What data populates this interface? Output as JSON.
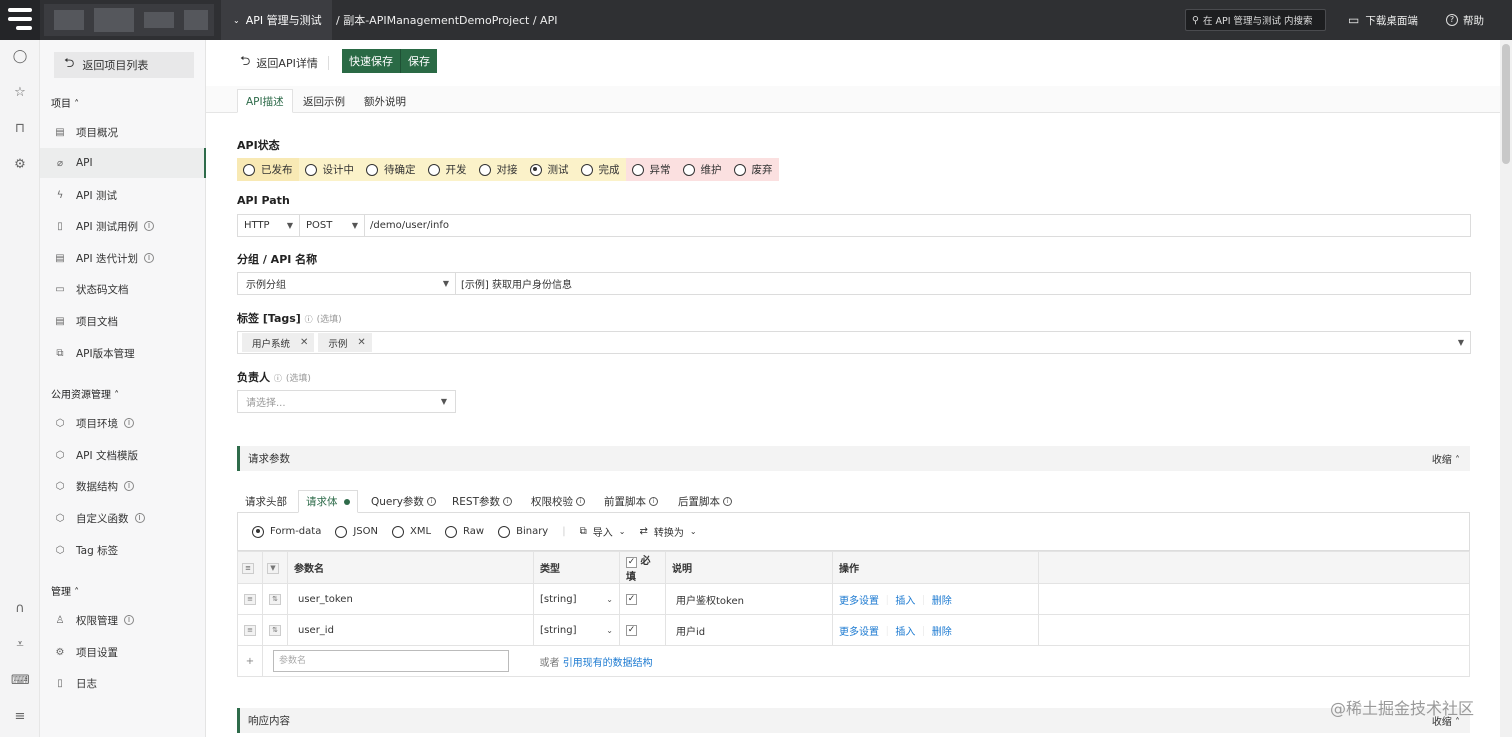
{
  "topbar": {
    "module_label": "API 管理与测试",
    "breadcrumb": "/ 副本-APIManagementDemoProject / API",
    "search_placeholder": "在 API 管理与测试 内搜索",
    "download_label": "下载桌面端",
    "help_label": "帮助"
  },
  "sidebar": {
    "back_label": "返回项目列表",
    "section_project": "项目",
    "section_public": "公用资源管理",
    "section_manage": "管理",
    "project_items": [
      {
        "label": "项目概况"
      },
      {
        "label": "API"
      },
      {
        "label": "API 测试"
      },
      {
        "label": "API 测试用例"
      },
      {
        "label": "API 迭代计划"
      },
      {
        "label": "状态码文档"
      },
      {
        "label": "项目文档"
      },
      {
        "label": "API版本管理"
      }
    ],
    "public_items": [
      {
        "label": "项目环境"
      },
      {
        "label": "API 文档模版"
      },
      {
        "label": "数据结构"
      },
      {
        "label": "自定义函数"
      },
      {
        "label": "Tag 标签"
      }
    ],
    "manage_items": [
      {
        "label": "权限管理"
      },
      {
        "label": "项目设置"
      },
      {
        "label": "日志"
      }
    ]
  },
  "toolbar": {
    "back_label": "返回API详情",
    "quick_save": "快速保存",
    "save": "保存"
  },
  "subtabs": [
    "API描述",
    "返回示例",
    "额外说明"
  ],
  "form": {
    "status_label": "API状态",
    "statuses": [
      {
        "label": "已发布",
        "color": "#f8e9b4"
      },
      {
        "label": "设计中",
        "color": "#fbf2c9"
      },
      {
        "label": "待确定",
        "color": "#fbf2c9"
      },
      {
        "label": "开发",
        "color": "#fbf2c9"
      },
      {
        "label": "对接",
        "color": "#fbf2c9"
      },
      {
        "label": "测试",
        "color": "#fbf2c9"
      },
      {
        "label": "完成",
        "color": "#fbf2c9"
      },
      {
        "label": "异常",
        "color": "#fbe0e0"
      },
      {
        "label": "维护",
        "color": "#fbe0e0"
      },
      {
        "label": "废弃",
        "color": "#fbe0e0"
      }
    ],
    "selected_status": "测试",
    "path_label": "API Path",
    "protocol": "HTTP",
    "method": "POST",
    "path": "/demo/user/info",
    "name_label": "分组 / API 名称",
    "group": "示例分组",
    "api_name": "[示例] 获取用户身份信息",
    "tags_label": "标签 [Tags]",
    "optional": "(选填)",
    "tags": [
      "用户系统",
      "示例"
    ],
    "owner_label": "负责人",
    "owner_placeholder": "请选择..."
  },
  "request": {
    "title": "请求参数",
    "collapse": "收缩",
    "tabs": [
      {
        "label": "请求头部"
      },
      {
        "label": "请求体"
      },
      {
        "label": "Query参数"
      },
      {
        "label": "REST参数"
      },
      {
        "label": "权限校验"
      },
      {
        "label": "前置脚本"
      },
      {
        "label": "后置脚本"
      }
    ],
    "body_types": [
      "Form-data",
      "JSON",
      "XML",
      "Raw",
      "Binary"
    ],
    "selected_body_type": "Form-data",
    "import_label": "导入",
    "convert_label": "转换为",
    "columns": {
      "name": "参数名",
      "type": "类型",
      "required": "必填",
      "desc": "说明",
      "ops": "操作"
    },
    "rows": [
      {
        "name": "user_token",
        "type": "[string]",
        "desc": "用户鉴权token",
        "more": "更多设置",
        "insert": "插入",
        "delete": "删除"
      },
      {
        "name": "user_id",
        "type": "[string]",
        "desc": "用户id",
        "more": "更多设置",
        "insert": "插入",
        "delete": "删除"
      }
    ],
    "new_param_placeholder": "参数名",
    "or_label": "或者",
    "ref_label": "引用现有的数据结构"
  },
  "response": {
    "title": "响应内容",
    "collapse": "收缩"
  },
  "watermark": "@稀土掘金技术社区"
}
